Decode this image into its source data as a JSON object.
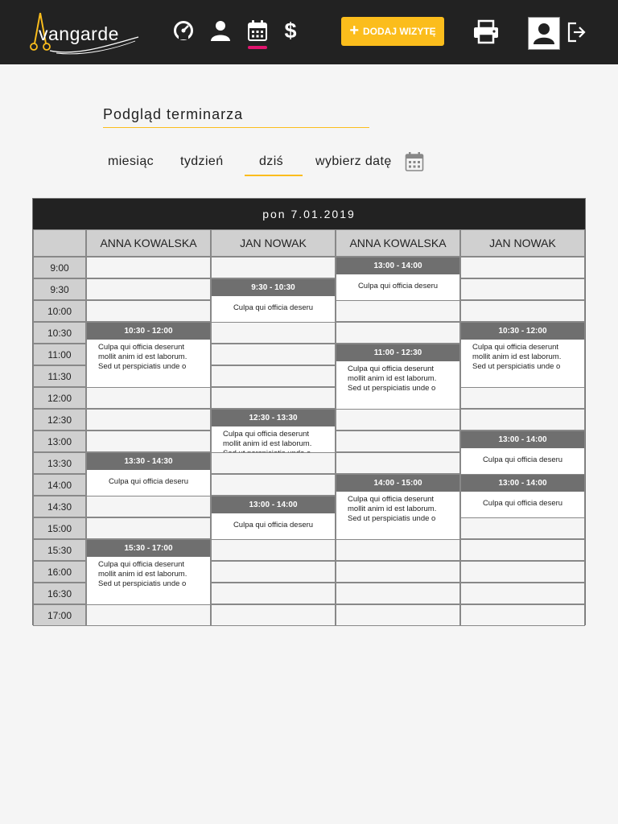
{
  "app": {
    "name": "vangarde"
  },
  "header": {
    "nav": [
      {
        "icon": "speedometer-icon"
      },
      {
        "icon": "user-icon"
      },
      {
        "icon": "calendar-icon",
        "active": true
      },
      {
        "icon": "dollar-icon"
      }
    ],
    "add_visit_label": "DODAJ WIZYTĘ",
    "print_icon": "printer-icon",
    "avatar_icon": "user-avatar-icon",
    "logout_icon": "logout-icon"
  },
  "colors": {
    "accent": "#fbbd1c",
    "active_nav": "#e0156e",
    "header_bg": "#222222",
    "event_head": "#6f6f6f"
  },
  "title": "Podgląd terminarza",
  "views": [
    {
      "label": "miesiąc",
      "active": false
    },
    {
      "label": "tydzień",
      "active": false
    },
    {
      "label": "dziś",
      "active": true
    },
    {
      "label": "wybierz datę",
      "active": false
    }
  ],
  "calendar": {
    "date_label": "pon 7.01.2019",
    "columns": [
      "ANNA KOWALSKA",
      "JAN NOWAK",
      "ANNA KOWALSKA",
      "JAN NOWAK"
    ],
    "times": [
      "9:00",
      "9:30",
      "10:00",
      "10:30",
      "11:00",
      "11:30",
      "12:00",
      "12:30",
      "13:00",
      "13:30",
      "14:00",
      "14:30",
      "15:00",
      "15:30",
      "16:00",
      "16:30",
      "17:00"
    ],
    "events": [
      {
        "col": 0,
        "start": "10:30",
        "end": "12:00",
        "time": "10:30 - 12:00",
        "desc": [
          "Culpa qui officia deserunt",
          "mollit anim id est laborum.",
          "Sed ut perspiciatis unde o"
        ]
      },
      {
        "col": 0,
        "start": "13:30",
        "end": "14:30",
        "time": "13:30 - 14:30",
        "desc": [
          "Culpa qui officia deseru"
        ]
      },
      {
        "col": 0,
        "start": "15:30",
        "end": "17:00",
        "time": "15:30 - 17:00",
        "desc": [
          "Culpa qui officia deserunt",
          "mollit anim id est laborum.",
          "Sed ut perspiciatis unde o"
        ]
      },
      {
        "col": 1,
        "start": "9:30",
        "end": "10:30",
        "time": "9:30 - 10:30",
        "desc": [
          "Culpa qui officia deseru"
        ]
      },
      {
        "col": 1,
        "start": "12:30",
        "end": "13:30",
        "time": "12:30 - 13:30",
        "desc": [
          "Culpa qui officia deserunt",
          "mollit anim id est laborum.",
          "Sed ut perspiciatis unde o"
        ]
      },
      {
        "col": 1,
        "start": "14:30",
        "end": "15:30",
        "time": "13:00 - 14:00",
        "desc": [
          "Culpa qui officia deseru"
        ]
      },
      {
        "col": 2,
        "start": "9:00",
        "end": "10:00",
        "time": "13:00 - 14:00",
        "desc": [
          "Culpa qui officia deseru"
        ]
      },
      {
        "col": 2,
        "start": "11:00",
        "end": "12:30",
        "time": "11:00 - 12:30",
        "desc": [
          "Culpa qui officia deserunt",
          "mollit anim id est laborum.",
          "Sed ut perspiciatis unde o"
        ]
      },
      {
        "col": 2,
        "start": "14:00",
        "end": "15:30",
        "time": "14:00 - 15:00",
        "desc": [
          "Culpa qui officia deserunt",
          "mollit anim id est laborum.",
          "Sed ut perspiciatis unde o"
        ]
      },
      {
        "col": 3,
        "start": "10:30",
        "end": "12:00",
        "time": "10:30 - 12:00",
        "desc": [
          "Culpa qui officia deserunt",
          "mollit anim id est laborum.",
          "Sed ut perspiciatis unde o"
        ]
      },
      {
        "col": 3,
        "start": "13:00",
        "end": "14:00",
        "time": "13:00 - 14:00",
        "desc": [
          "Culpa qui officia deseru"
        ]
      },
      {
        "col": 3,
        "start": "14:00",
        "end": "15:00",
        "time": "13:00 - 14:00",
        "desc": [
          "Culpa qui officia deseru"
        ]
      }
    ]
  }
}
